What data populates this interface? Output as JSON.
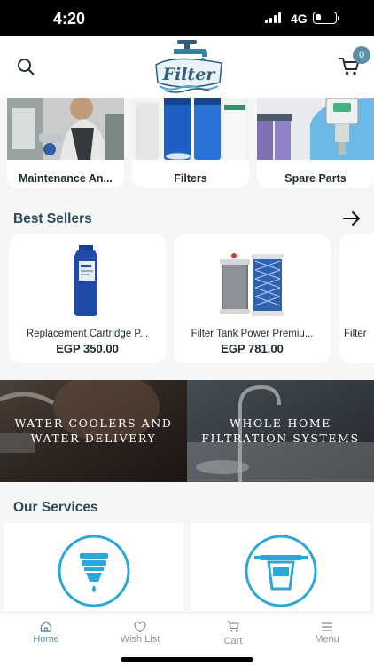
{
  "status_bar": {
    "time": "4:20",
    "network": "4G",
    "battery_level": 0.3
  },
  "header": {
    "logo_text": "Filter",
    "cart_count": "0",
    "icons": {
      "search": "search-icon",
      "cart": "cart-icon"
    }
  },
  "categories": [
    {
      "label": "Maintenance An..."
    },
    {
      "label": "Filters"
    },
    {
      "label": "Spare Parts"
    }
  ],
  "best_sellers": {
    "title": "Best Sellers",
    "products": [
      {
        "name": "Replacement Cartridge P...",
        "price": "EGP 350.00"
      },
      {
        "name": "Filter Tank Power Premiu...",
        "price": "EGP 781.00"
      },
      {
        "name": "Filter",
        "price": ""
      }
    ]
  },
  "banners": [
    {
      "text": "WATER COOLERS AND WATER DELIVERY"
    },
    {
      "text": "WHOLE-HOME FILTRATION SYSTEMS"
    }
  ],
  "services": {
    "title": "Our Services"
  },
  "bottom_nav": [
    {
      "label": "Home",
      "icon": "home-icon",
      "active": true
    },
    {
      "label": "Wish List",
      "icon": "heart-icon",
      "active": false
    },
    {
      "label": "Cart",
      "icon": "cart-icon",
      "active": false
    },
    {
      "label": "Menu",
      "icon": "menu-icon",
      "active": false
    }
  ],
  "colors": {
    "accent": "#5b8fa6",
    "service_icon": "#29a8d8",
    "title": "#2d4a5a"
  }
}
